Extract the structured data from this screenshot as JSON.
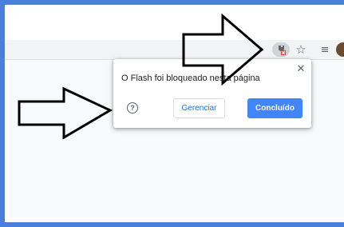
{
  "popup": {
    "message": "O Flash foi bloqueado nesta página",
    "close_symbol": "✕",
    "help_symbol": "?",
    "manage_label": "Gerenciar",
    "done_label": "Concluído"
  },
  "toolbar": {
    "icons": [
      "flash-blocked-icon",
      "star-icon",
      "reading-list-icon",
      "profile-avatar"
    ]
  },
  "colors": {
    "frame": "#4a7fdc",
    "primary_button": "#4285f4",
    "link_text": "#1a73e8"
  }
}
